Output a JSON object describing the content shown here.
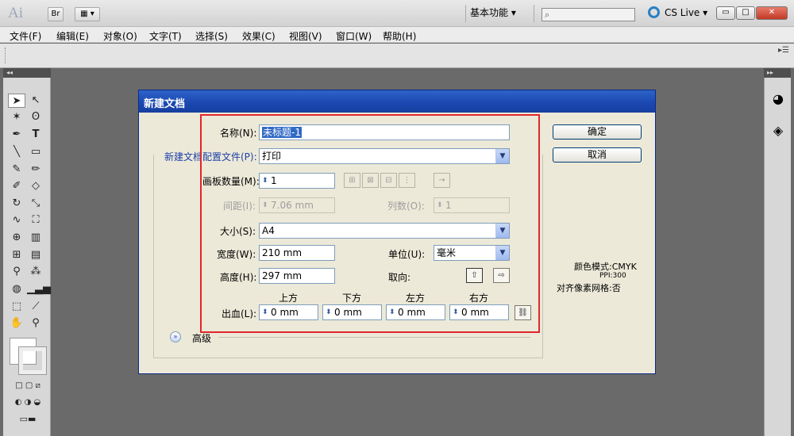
{
  "app": {
    "logo": "Ai",
    "bridge_label": "Br",
    "workspace": "基本功能",
    "cs_live": "CS Live"
  },
  "menu": [
    "文件(F)",
    "编辑(E)",
    "对象(O)",
    "文字(T)",
    "选择(S)",
    "效果(C)",
    "视图(V)",
    "窗口(W)",
    "帮助(H)"
  ],
  "dialog": {
    "title": "新建文档",
    "name_label": "名称(N):",
    "name_value": "未标题-1",
    "profile_label": "新建文档配置文件(P):",
    "profile_value": "打印",
    "artboards_label": "画板数量(M):",
    "artboards_value": "1",
    "spacing_label": "间距(I):",
    "spacing_value": "7.06 mm",
    "columns_label": "列数(O):",
    "columns_value": "1",
    "size_label": "大小(S):",
    "size_value": "A4",
    "width_label": "宽度(W):",
    "width_value": "210 mm",
    "units_label": "单位(U):",
    "units_value": "毫米",
    "height_label": "高度(H):",
    "height_value": "297 mm",
    "orientation_label": "取向:",
    "bleed_label": "出血(L):",
    "bleed_top_label": "上方",
    "bleed_bottom_label": "下方",
    "bleed_left_label": "左方",
    "bleed_right_label": "右方",
    "bleed_top": "0 mm",
    "bleed_bottom": "0 mm",
    "bleed_left": "0 mm",
    "bleed_right": "0 mm",
    "advanced_label": "高级",
    "ok_label": "确定",
    "cancel_label": "取消",
    "color_mode": "颜色模式:CMYK",
    "ppi": "PPI:300",
    "pixel_grid": "对齐像素网格:否"
  },
  "colors": {
    "title_bar": "#1b47b0",
    "highlight_box": "#e0262c",
    "dialog_bg": "#ece9d8",
    "canvas_bg": "#6a6a6a"
  }
}
